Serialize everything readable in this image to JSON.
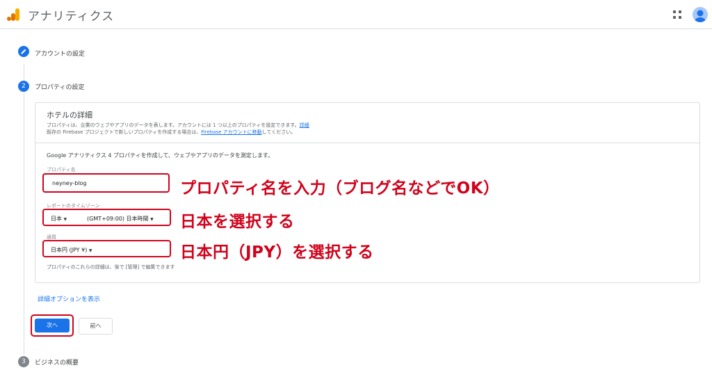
{
  "header": {
    "app_title": "アナリティクス"
  },
  "steps": [
    {
      "label": "アカウントの設定",
      "status": "completed"
    },
    {
      "number": "2",
      "label": "プロパティの設定",
      "status": "active"
    },
    {
      "number": "3",
      "label": "ビジネスの概要",
      "status": "upcoming"
    }
  ],
  "card": {
    "title": "ホテルの詳細",
    "desc_line1": "プロパティは、企業のウェブやアプリのデータを表します。アカウントには 1 つ以上のプロパティを設定できます。",
    "desc_line1_link": "詳細",
    "desc_line2_prefix": "既存の Firebase プロジェクトで新しいプロパティを作成する場合は、",
    "desc_line2_link": "Firebase アカウントに移動",
    "desc_line2_suffix": "してください。",
    "intro": "Google アナリティクス 4 プロパティを作成して、ウェブやアプリのデータを測定します。",
    "property_name_label": "プロパティ名",
    "property_name_value": "neyney-blog",
    "timezone_label": "レポートのタイムゾーン",
    "timezone_country": "日本",
    "timezone_zone": "(GMT+09:00) 日本時間",
    "currency_label": "通貨",
    "currency_value": "日本円 (JPY ¥)",
    "note": "プロパティのこれらの詳細は、後で [管理] で編集できます"
  },
  "annotations": {
    "property_name": "プロパティ名を入力（ブログ名などでOK）",
    "timezone": "日本を選択する",
    "currency": "日本円（JPY）を選択する"
  },
  "advanced_link": "詳細オプションを表示",
  "buttons": {
    "next": "次へ",
    "prev": "前へ"
  },
  "colors": {
    "accent": "#1a73e8",
    "annotation": "#d0021b",
    "logo_orange": "#f9ab00",
    "logo_dark": "#e37400"
  }
}
